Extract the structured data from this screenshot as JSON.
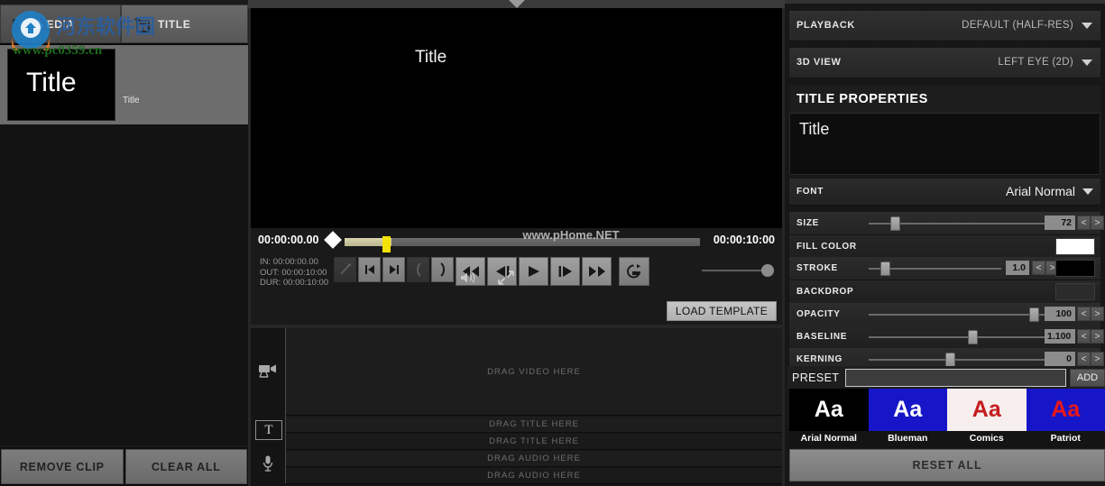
{
  "left_panel": {
    "tabs": [
      {
        "id": "media",
        "label": "MEDIA",
        "icon": "film-strip-icon"
      },
      {
        "id": "title",
        "label": "TITLE",
        "icon": "add-title-icon"
      }
    ],
    "thumbnail": {
      "caption": "Title",
      "label": "Title"
    },
    "buttons": [
      {
        "id": "remove-clip",
        "label": "REMOVE CLIP"
      },
      {
        "id": "clear-all",
        "label": "CLEAR ALL"
      }
    ]
  },
  "preview": {
    "title_text": "Title",
    "watermark": "www.pHome.NET"
  },
  "transport": {
    "current_timecode": "00:00:00.00",
    "total_timecode": "00:00:10:00",
    "in_label": "IN:",
    "in_value": "00:00:00.00",
    "out_label": "OUT:",
    "out_value": "00:00:10:00",
    "dur_label": "DUR:",
    "dur_value": "00:00:10:00",
    "buttons": [
      {
        "id": "mark-cut",
        "icon": "razor-icon",
        "enabled": false
      },
      {
        "id": "go-to-start",
        "icon": "skip-back-icon",
        "enabled": true
      },
      {
        "id": "go-to-end",
        "icon": "skip-forward-icon",
        "enabled": true
      },
      {
        "id": "mark-in",
        "icon": "mark-in-icon",
        "enabled": false
      },
      {
        "id": "mark-out",
        "icon": "mark-out-icon",
        "enabled": true
      },
      {
        "id": "rewind",
        "icon": "rewind-icon",
        "enabled": true
      },
      {
        "id": "step-back",
        "icon": "step-back-icon",
        "enabled": true
      },
      {
        "id": "play",
        "icon": "play-icon",
        "enabled": true
      },
      {
        "id": "step-forward",
        "icon": "step-forward-icon",
        "enabled": true
      },
      {
        "id": "fast-forward",
        "icon": "fast-forward-icon",
        "enabled": true
      },
      {
        "id": "loop",
        "icon": "loop-icon",
        "enabled": true
      }
    ],
    "volume_icon": "speaker-icon",
    "fullscreen_icon": "fullscreen-icon",
    "load_template_label": "LOAD TEMPLATE"
  },
  "tracks": [
    {
      "id": "video",
      "icon": "video-camera-icon",
      "placeholder": "DRAG VIDEO HERE"
    },
    {
      "id": "title-1",
      "icon": "text-t-icon",
      "placeholder": "DRAG TITLE HERE"
    },
    {
      "id": "title-2",
      "icon": "",
      "placeholder": "DRAG TITLE HERE"
    },
    {
      "id": "audio-1",
      "icon": "microphone-icon",
      "placeholder": "DRAG AUDIO HERE"
    },
    {
      "id": "audio-2",
      "icon": "",
      "placeholder": "DRAG AUDIO HERE"
    }
  ],
  "right_panel": {
    "playback": {
      "label": "PLAYBACK",
      "value": "DEFAULT (HALF-RES)"
    },
    "view3d": {
      "label": "3D VIEW",
      "value": "LEFT EYE (2D)"
    },
    "title_properties_header": "TITLE PROPERTIES",
    "title_text_value": "Title",
    "font": {
      "label": "FONT",
      "value": "Arial Normal"
    },
    "properties": [
      {
        "id": "size",
        "label": "SIZE",
        "value": "72",
        "slider": 0.13,
        "has_slider": true,
        "has_steppers": true,
        "swatch": null
      },
      {
        "id": "fill-color",
        "label": "FILL COLOR",
        "value": null,
        "has_slider": false,
        "has_steppers": false,
        "swatch": "#ffffff"
      },
      {
        "id": "stroke",
        "label": "STROKE",
        "value": "1.0",
        "slider": 0.09,
        "has_slider": true,
        "has_steppers": true,
        "swatch": "#000000"
      },
      {
        "id": "backdrop",
        "label": "BACKDROP",
        "value": null,
        "has_slider": false,
        "has_steppers": false,
        "swatch": "#2b2b2b"
      },
      {
        "id": "opacity",
        "label": "OPACITY",
        "value": "100",
        "slider": 0.97,
        "has_slider": true,
        "has_steppers": true,
        "swatch": null
      },
      {
        "id": "baseline",
        "label": "BASELINE",
        "value": "1.100",
        "slider": 0.59,
        "has_slider": true,
        "has_steppers": true,
        "swatch": null
      },
      {
        "id": "kerning",
        "label": "KERNING",
        "value": "0",
        "slider": 0.5,
        "has_slider": true,
        "has_steppers": true,
        "swatch": null
      }
    ],
    "stepper_prev": "<",
    "stepper_next": ">",
    "preset": {
      "label": "PRESET",
      "input_value": "",
      "add_label": "ADD"
    },
    "preset_cards": [
      {
        "name": "Arial Normal",
        "sample": "Aa",
        "bg": "#000000",
        "fg": "#ffffff"
      },
      {
        "name": "Blueman",
        "sample": "Aa",
        "bg": "#1616c8",
        "fg": "#ffffff"
      },
      {
        "name": "Comics",
        "sample": "Aa",
        "bg": "#f7eeee",
        "fg": "#c41c1c"
      },
      {
        "name": "Patriot",
        "sample": "Aa",
        "bg": "#1616c8",
        "fg": "#e81818"
      }
    ],
    "reset_all_label": "RESET ALL"
  },
  "watermark": {
    "cn_text": "河东软件园",
    "url_text": "www.pc0359.cn"
  }
}
